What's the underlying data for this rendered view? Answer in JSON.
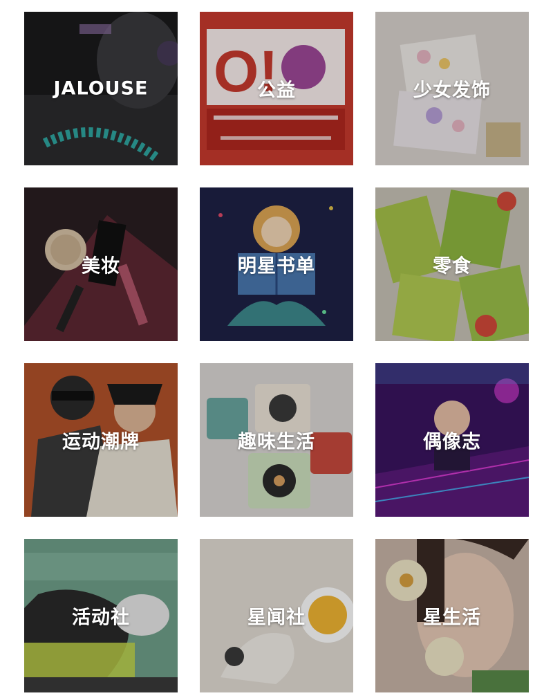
{
  "tiles": [
    {
      "label": "JALOUSE",
      "icon": "photo-jalouse",
      "colors": {
        "base": "#1a1a1c",
        "accent": "#2fa7a1",
        "hi": "#8a6ea0"
      }
    },
    {
      "label": "公益",
      "icon": "photo-charity",
      "colors": {
        "base": "#c93a2e",
        "accent": "#ffffff",
        "hi": "#8e2a8a"
      }
    },
    {
      "label": "少女发饰",
      "icon": "photo-hair-accessories",
      "colors": {
        "base": "#d9d4cf",
        "accent": "#e8b6c4",
        "hi": "#f0c96a"
      }
    },
    {
      "label": "美妆",
      "icon": "photo-makeup",
      "colors": {
        "base": "#2a1e22",
        "accent": "#b0556a",
        "hi": "#d8c4a8"
      }
    },
    {
      "label": "明星书单",
      "icon": "photo-book-list",
      "colors": {
        "base": "#1e2246",
        "accent": "#4a78b0",
        "hi": "#e0a855"
      }
    },
    {
      "label": "零食",
      "icon": "photo-snacks",
      "colors": {
        "base": "#c8c4b8",
        "accent": "#a7c24a",
        "hi": "#d44a3a"
      }
    },
    {
      "label": "运动潮牌",
      "icon": "photo-sportswear",
      "colors": {
        "base": "#b3522a",
        "accent": "#2a2a2a",
        "hi": "#e9e3d6"
      }
    },
    {
      "label": "趣味生活",
      "icon": "photo-fun-life",
      "colors": {
        "base": "#dcd8d6",
        "accent": "#6aa6a0",
        "hi": "#c84a3e"
      }
    },
    {
      "label": "偶像志",
      "icon": "photo-idol",
      "colors": {
        "base": "#3a1460",
        "accent": "#d63ad1",
        "hi": "#4aa0e6"
      }
    },
    {
      "label": "活动社",
      "icon": "photo-events",
      "colors": {
        "base": "#6fa08a",
        "accent": "#c6d84a",
        "hi": "#2a2a2a"
      }
    },
    {
      "label": "星闻社",
      "icon": "photo-star-news",
      "colors": {
        "base": "#e3ddd5",
        "accent": "#f2b632",
        "hi": "#3a3a3a"
      }
    },
    {
      "label": "星生活",
      "icon": "photo-star-life",
      "colors": {
        "base": "#c9b5a8",
        "accent": "#f1e8c9",
        "hi": "#5a8a4a"
      }
    }
  ]
}
